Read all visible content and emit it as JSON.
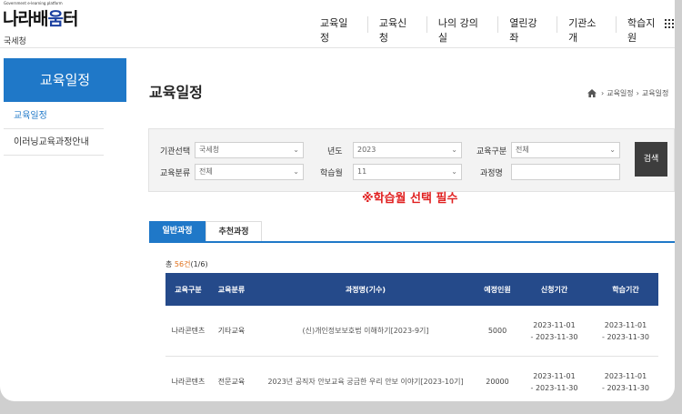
{
  "header": {
    "logo_small": "Government e-learning platform",
    "logo_main_a": "나라배",
    "logo_main_b": "움",
    "logo_main_c": "터",
    "org": "국세청",
    "nav": [
      "교육일정",
      "교육신청",
      "나의 강의실",
      "열린강좌",
      "기관소개",
      "학습지원"
    ],
    "menu_icon": "grid-icon"
  },
  "sidebar": {
    "title": "교육일정",
    "items": [
      "교육일정",
      "이러닝교육과정안내"
    ]
  },
  "main": {
    "title": "교육일정",
    "breadcrumb": [
      "교육일정",
      "교육일정"
    ],
    "home_icon": "home-icon"
  },
  "filter": {
    "org_label": "기관선택",
    "org_value": "국세청",
    "year_label": "년도",
    "year_value": "2023",
    "type_label": "교육구분",
    "type_value": "전체",
    "category_label": "교육분류",
    "category_value": "전체",
    "month_label": "학습월",
    "month_value": "11",
    "course_label": "과정명",
    "course_value": "",
    "search_label": "검색"
  },
  "notice": "※학습월 선택 필수",
  "tabs": [
    "일반과정",
    "추천과정"
  ],
  "count": {
    "prefix": "총 ",
    "num": "56건",
    "suffix": "(1/6)"
  },
  "table": {
    "headers": [
      "교육구분",
      "교육분류",
      "과정명(기수)",
      "예정인원",
      "신청기간",
      "학습기간"
    ],
    "rows": [
      {
        "type": "나라콘텐츠",
        "category": "기타교육",
        "title": "(신)개인정보보호법 이해하기[2023-9기]",
        "capacity": "5000",
        "apply_start": "2023-11-01",
        "apply_end": "- 2023-11-30",
        "study_start": "2023-11-01",
        "study_end": "- 2023-11-30"
      },
      {
        "type": "나라콘텐츠",
        "category": "전문교육",
        "title": "2023년 공직자 안보교육 궁금한 우리 안보 이야기[2023-10기]",
        "capacity": "20000",
        "apply_start": "2023-11-01",
        "apply_end": "- 2023-11-30",
        "study_start": "2023-11-01",
        "study_end": "- 2023-11-30"
      }
    ]
  },
  "colors": {
    "primary": "#1f78c8",
    "table_header": "#254a8a",
    "notice": "#e02020",
    "count_accent": "#e0701a",
    "search_button": "#3d3d3d"
  }
}
